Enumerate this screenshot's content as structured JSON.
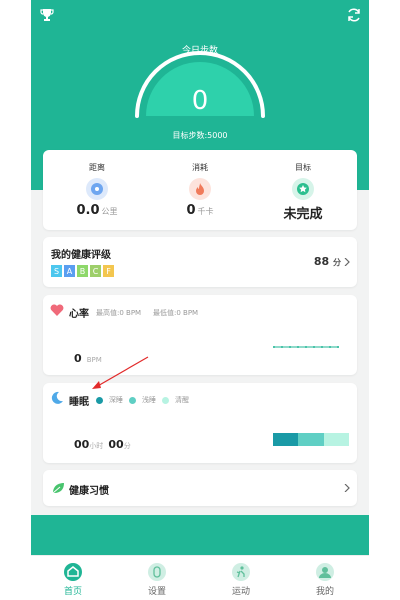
{
  "hero": {
    "steps_title": "今日步数",
    "steps_value": "0",
    "goal_text": "目标步数:5000",
    "color": "#1fb595"
  },
  "stats": [
    {
      "label": "距离",
      "value": "0.0",
      "unit": "公里",
      "icon": "location-icon",
      "color": "#6ea6f0"
    },
    {
      "label": "消耗",
      "value": "0",
      "unit": "千卡",
      "icon": "flame-icon",
      "color": "#f07a5a"
    },
    {
      "label": "目标",
      "value": "未完成",
      "unit": "",
      "icon": "star-badge-icon",
      "color": "#2bbf8f"
    }
  ],
  "health": {
    "title": "我的健康评级",
    "grades": [
      {
        "label": "S",
        "color": "#4dc7ee"
      },
      {
        "label": "A",
        "color": "#5a9ef0"
      },
      {
        "label": "B",
        "color": "#8ed86a"
      },
      {
        "label": "C",
        "color": "#9ecf6a"
      },
      {
        "label": "F",
        "color": "#f3c64f"
      }
    ],
    "score": "88",
    "score_unit": "分"
  },
  "heart": {
    "title": "心率",
    "max_label": "最高值:0 BPM",
    "min_label": "最低值:0 BPM",
    "value": "0",
    "unit": "BPM"
  },
  "sleep": {
    "title": "睡眠",
    "legend": [
      {
        "label": "深睡",
        "color": "#1a9aa6"
      },
      {
        "label": "浅睡",
        "color": "#5fcfc4"
      },
      {
        "label": "清醒",
        "color": "#b7f3e2"
      }
    ],
    "hours": "00",
    "hours_unit": "小时",
    "minutes": "00",
    "minutes_unit": "分"
  },
  "habits": {
    "title": "健康习惯"
  },
  "tabs": [
    {
      "label": "首页",
      "icon": "home-icon",
      "active": true
    },
    {
      "label": "设置",
      "icon": "settings-icon",
      "active": false
    },
    {
      "label": "运动",
      "icon": "run-icon",
      "active": false
    },
    {
      "label": "我的",
      "icon": "profile-icon",
      "active": false
    }
  ]
}
